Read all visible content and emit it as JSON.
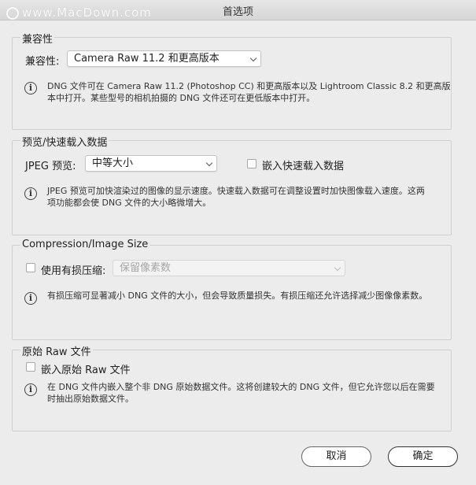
{
  "window": {
    "title": "首选项",
    "watermark": "www.MacDown.com"
  },
  "compatibility": {
    "legend": "兼容性",
    "label": "兼容性:",
    "selected": "Camera Raw 11.2 和更高版本",
    "info_line1": "DNG 文件可在 Camera Raw 11.2 (Photoshop CC) 和更高版本以及 Lightroom Classic 8.2 和更高版",
    "info_line2": "本中打开。某些型号的相机拍摄的 DNG 文件还可在更低版本中打开。"
  },
  "preview": {
    "legend": "预览/快速载入数据",
    "jpeg_label": "JPEG 预览:",
    "jpeg_selected": "中等大小",
    "embed_fast_load_label": "嵌入快速载入数据",
    "info_line1": "JPEG 预览可加快渲染过的图像的显示速度。快速载入数据可在调整设置时加快图像载入速度。这两",
    "info_line2": "项功能都会使 DNG 文件的大小略微增大。"
  },
  "compression": {
    "legend": "Compression/Image Size",
    "lossy_label": "使用有损压缩:",
    "lossy_selected": "保留像素数",
    "info_line1": "有损压缩可显著减小 DNG 文件的大小，但会导致质量损失。有损压缩还允许选择减少图像像素数。"
  },
  "raw": {
    "legend": "原始 Raw 文件",
    "embed_raw_label": "嵌入原始 Raw 文件",
    "info_line1": "在 DNG 文件内嵌入整个非 DNG 原始数据文件。这将创建较大的 DNG 文件，但它允许您以后在需要",
    "info_line2": "时抽出原始数据文件。"
  },
  "buttons": {
    "cancel": "取消",
    "ok": "确定"
  },
  "icons": {
    "info": "i"
  }
}
